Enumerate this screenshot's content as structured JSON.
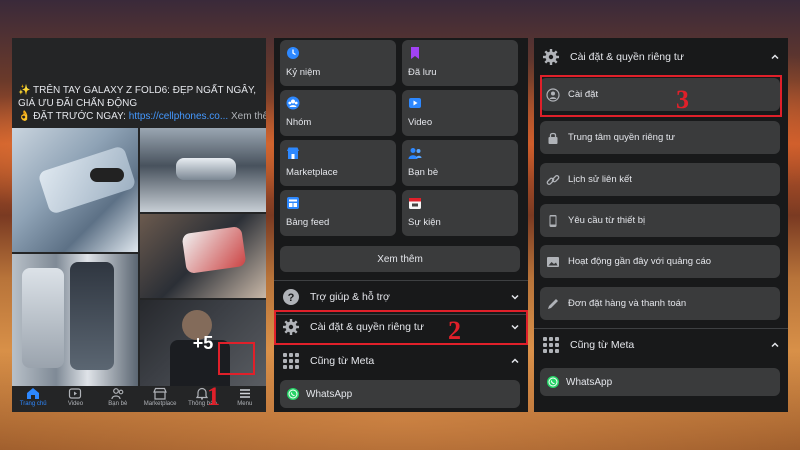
{
  "colors": {
    "accent_red": "#e0202a",
    "link_blue": "#4599ff",
    "panel_bg": "#18191a",
    "tile_bg": "#3a3b3c"
  },
  "panel1": {
    "post_text": "✨ TRÊN TAY GALAXY Z FOLD6: ĐẸP NGẤT NGÂY, GIÁ ƯU ĐÃI CHẤN ĐỘNG",
    "cta_prefix": "👌 ĐẶT TRƯỚC NGAY: ",
    "cta_link": "https://cellphones.co...",
    "see_more": "Xem thêm",
    "photo_overlay": "+5",
    "nav": [
      {
        "label": "Trang chủ",
        "icon": "home-icon",
        "active": true
      },
      {
        "label": "Video",
        "icon": "video-icon",
        "active": false
      },
      {
        "label": "Bạn bè",
        "icon": "friends-icon",
        "active": false
      },
      {
        "label": "Marketplace",
        "icon": "marketplace-icon",
        "active": false
      },
      {
        "label": "Thông báo",
        "icon": "bell-icon",
        "active": false
      },
      {
        "label": "Menu",
        "icon": "menu-icon",
        "active": false
      }
    ]
  },
  "panel2": {
    "tiles": [
      {
        "label": "Kỷ niệm",
        "icon": "clock-icon"
      },
      {
        "label": "Đã lưu",
        "icon": "bookmark-icon"
      },
      {
        "label": "Nhóm",
        "icon": "group-icon"
      },
      {
        "label": "Video",
        "icon": "video-icon"
      },
      {
        "label": "Marketplace",
        "icon": "marketplace-icon"
      },
      {
        "label": "Bạn bè",
        "icon": "friends-icon"
      },
      {
        "label": "Bảng feed",
        "icon": "feed-icon"
      },
      {
        "label": "Sự kiện",
        "icon": "calendar-icon"
      }
    ],
    "see_more": "Xem thêm",
    "help_label": "Trợ giúp & hỗ trợ",
    "settings_label": "Cài đặt & quyền riêng tư",
    "meta_label": "Cũng từ Meta",
    "whatsapp_label": "WhatsApp"
  },
  "panel3": {
    "header_label": "Cài đặt & quyền riêng tư",
    "items": [
      {
        "label": "Cài đặt",
        "icon": "user-circle-icon"
      },
      {
        "label": "Trung tâm quyền riêng tư",
        "icon": "lock-icon"
      },
      {
        "label": "Lịch sử liên kết",
        "icon": "link-icon"
      },
      {
        "label": "Yêu cầu từ thiết bị",
        "icon": "device-icon"
      },
      {
        "label": "Hoạt động gần đây với quảng cáo",
        "icon": "image-icon"
      },
      {
        "label": "Đơn đặt hàng và thanh toán",
        "icon": "pencil-icon"
      }
    ],
    "meta_label": "Cũng từ Meta",
    "whatsapp_label": "WhatsApp"
  },
  "steps": [
    "1",
    "2",
    "3"
  ]
}
